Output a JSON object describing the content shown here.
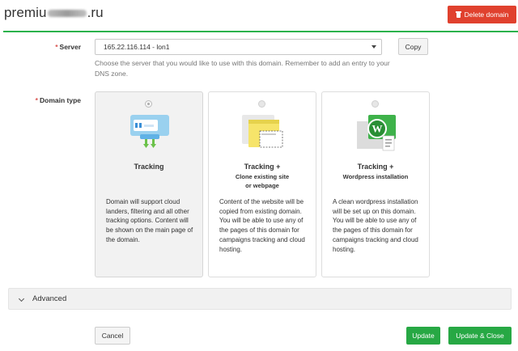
{
  "header": {
    "title_prefix": "premiu",
    "title_suffix": "ru",
    "delete_label": "Delete domain"
  },
  "server": {
    "label": "Server",
    "selected": "165.22.116.114 - lon1",
    "copy_label": "Copy",
    "help": "Choose the server that you would like to use with this domain. Remember to add an entry to your DNS zone."
  },
  "domain_type": {
    "label": "Domain type",
    "cards": [
      {
        "title": "Tracking",
        "subtitle": "",
        "description": "Domain will support cloud landers, filtering and all other tracking options. Content will be shown on the main page of the domain.",
        "selected": true,
        "icon": "tracking-icon"
      },
      {
        "title": "Tracking +",
        "subtitle_line1": "Clone existing site",
        "subtitle_line2": "or webpage",
        "description": "Content of the website will be copied from existing domain. You will be able to use any of the pages of this domain for campaigns tracking and cloud hosting.",
        "selected": false,
        "icon": "clone-site-icon"
      },
      {
        "title": "Tracking +",
        "subtitle_line1": "Wordpress installation",
        "description": "A clean wordpress installation will be set up on this domain. You will be able to use any of the pages of this domain for campaigns tracking and cloud hosting.",
        "selected": false,
        "icon": "wordpress-icon"
      }
    ]
  },
  "advanced": {
    "label": "Advanced"
  },
  "footer": {
    "cancel_label": "Cancel",
    "update_label": "Update",
    "update_close_label": "Update & Close"
  },
  "colors": {
    "accent_green": "#27a844",
    "danger_red": "#e0412e"
  }
}
